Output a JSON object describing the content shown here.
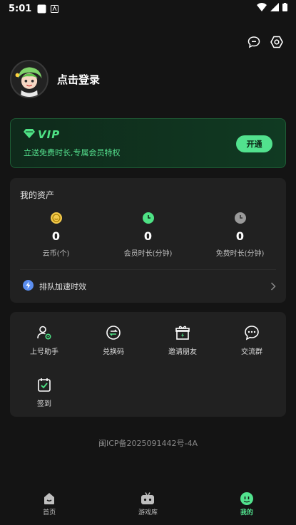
{
  "status_bar": {
    "time": "5:01"
  },
  "profile": {
    "login_text": "点击登录"
  },
  "vip": {
    "badge": "VIP",
    "subtitle": "立送免费时长,专属会员特权",
    "button": "开通"
  },
  "assets": {
    "title": "我的资产",
    "items": [
      {
        "value": "0",
        "label": "云币(个)",
        "icon": "coin-icon"
      },
      {
        "value": "0",
        "label": "会员时长(分钟)",
        "icon": "member-time-icon"
      },
      {
        "value": "0",
        "label": "免费时长(分钟)",
        "icon": "free-time-icon"
      }
    ],
    "queue_label": "排队加速时效"
  },
  "functions": {
    "items": [
      {
        "label": "上号助手",
        "icon": "account-assistant-icon"
      },
      {
        "label": "兑换码",
        "icon": "redeem-code-icon"
      },
      {
        "label": "邀请朋友",
        "icon": "invite-friend-icon"
      },
      {
        "label": "交流群",
        "icon": "chat-group-icon"
      },
      {
        "label": "签到",
        "icon": "check-in-icon"
      }
    ]
  },
  "icp": "闽ICP备2025091442号-4A",
  "nav": {
    "items": [
      {
        "label": "首页",
        "icon": "home-icon"
      },
      {
        "label": "游戏库",
        "icon": "game-library-icon"
      },
      {
        "label": "我的",
        "icon": "mine-icon"
      }
    ],
    "active": "我的"
  },
  "colors": {
    "accent": "#52e28e",
    "background": "#141414",
    "card": "#212121"
  }
}
